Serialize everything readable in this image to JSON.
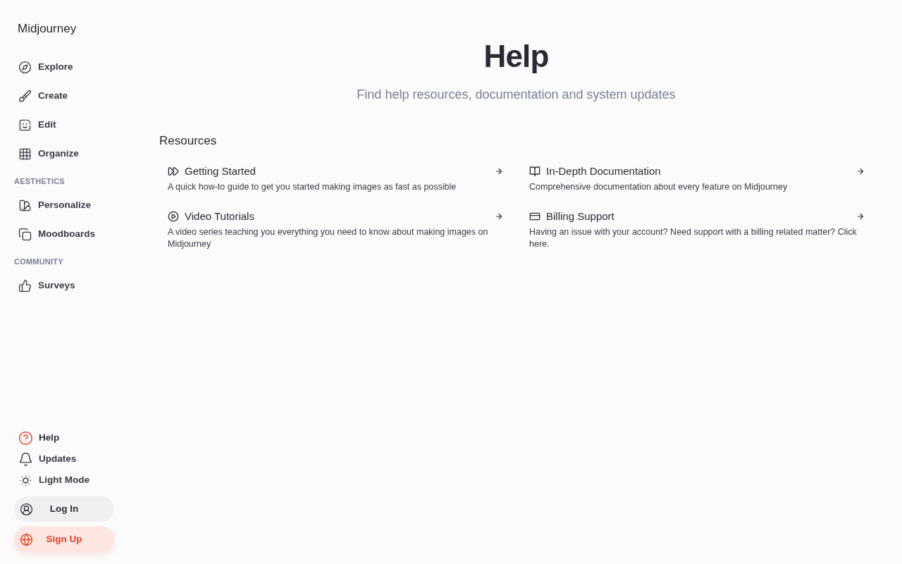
{
  "sidebar": {
    "brand": "Midjourney",
    "groups": [
      {
        "items": [
          {
            "label": "Explore",
            "selected": false
          },
          {
            "label": "Create",
            "selected": false
          },
          {
            "label": "Edit",
            "selected": false
          },
          {
            "label": "Organize",
            "selected": false
          }
        ]
      },
      {
        "heading": "AESTHETICS",
        "items": [
          {
            "label": "Personalize",
            "selected": false
          },
          {
            "label": "Moodboards",
            "selected": false
          }
        ]
      },
      {
        "heading": "COMMUNITY",
        "items": [
          {
            "label": "Surveys",
            "selected": false
          }
        ]
      }
    ],
    "footer_items": [
      {
        "label": "Help",
        "selected": true
      },
      {
        "label": "Updates",
        "selected": false
      },
      {
        "label": "Light Mode",
        "selected": false
      }
    ],
    "buttons": [
      {
        "label": "Log In",
        "kind": "secondary"
      },
      {
        "label": "Sign Up",
        "kind": "primary"
      }
    ]
  },
  "page": {
    "title": "Help",
    "subtitle": "Find help resources, documentation and system updates",
    "section_title": "Resources",
    "cards": [
      {
        "title": "Getting Started",
        "description": "A quick how-to guide to get you started making images as fast as possible"
      },
      {
        "title": "In-Depth Documentation",
        "description": "Comprehensive documentation about every feature on Midjourney"
      },
      {
        "title": "Video Tutorials",
        "description": "A video series teaching you everything you need to know about making images on Midjourney"
      },
      {
        "title": "Billing Support",
        "description": "Having an issue with your account? Need support with a billing related matter? Click here."
      }
    ]
  }
}
